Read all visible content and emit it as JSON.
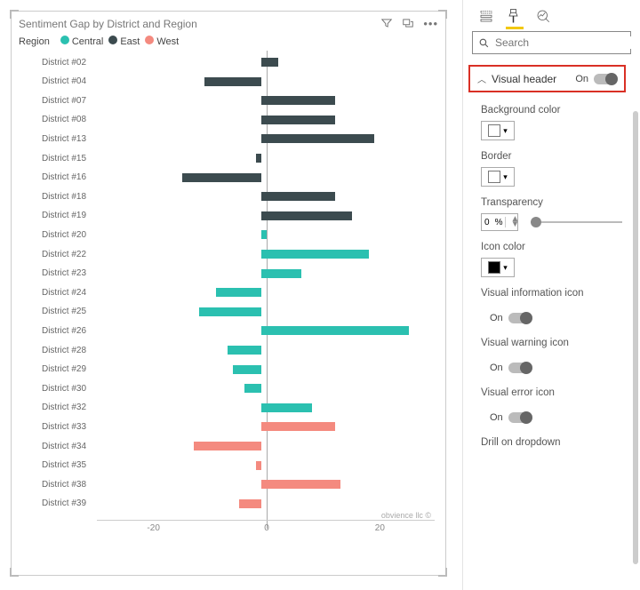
{
  "viz": {
    "title": "Sentiment Gap by District and Region",
    "legend_label": "Region",
    "legend": [
      {
        "name": "Central",
        "color": "#2bc0b0"
      },
      {
        "name": "East",
        "color": "#3c4b4f"
      },
      {
        "name": "West",
        "color": "#f48a7f"
      }
    ],
    "copyright": "obvience llc ©"
  },
  "actions": {
    "filter_icon": "filter-icon",
    "focus_icon": "focus-mode-icon",
    "more_icon": "more-options-icon"
  },
  "axis": {
    "ticks": [
      -20,
      0,
      20
    ],
    "min": -30,
    "max": 30
  },
  "chart_data": {
    "type": "bar",
    "orientation": "horizontal",
    "categories": [
      "District #02",
      "District #04",
      "District #07",
      "District #08",
      "District #13",
      "District #15",
      "District #16",
      "District #18",
      "District #19",
      "District #20",
      "District #22",
      "District #23",
      "District #24",
      "District #25",
      "District #26",
      "District #28",
      "District #29",
      "District #30",
      "District #32",
      "District #33",
      "District #34",
      "District #35",
      "District #38",
      "District #39"
    ],
    "series": [
      {
        "name": "Central",
        "color": "#2bc0b0",
        "values": [
          null,
          null,
          null,
          null,
          null,
          null,
          null,
          null,
          null,
          1,
          19,
          7,
          -8,
          -11,
          26,
          -6,
          -5,
          -3,
          9,
          null,
          null,
          null,
          null,
          null
        ]
      },
      {
        "name": "East",
        "color": "#3c4b4f",
        "values": [
          3,
          -10,
          13,
          13,
          20,
          -1,
          -14,
          13,
          16,
          null,
          null,
          null,
          null,
          null,
          null,
          null,
          null,
          null,
          null,
          null,
          null,
          null,
          null,
          null
        ]
      },
      {
        "name": "West",
        "color": "#f48a7f",
        "values": [
          null,
          null,
          null,
          null,
          null,
          null,
          null,
          null,
          null,
          null,
          null,
          null,
          null,
          null,
          null,
          null,
          null,
          null,
          null,
          13,
          -12,
          -1,
          14,
          -4
        ]
      }
    ],
    "xlabel": "",
    "ylabel": "",
    "xlim": [
      -30,
      30
    ],
    "title": "Sentiment Gap by District and Region"
  },
  "format": {
    "search_placeholder": "Search",
    "section": {
      "label": "Visual header",
      "state": "On"
    },
    "props": {
      "bg_color": {
        "label": "Background color",
        "value": "#ffffff"
      },
      "border": {
        "label": "Border",
        "value": "#ffffff"
      },
      "transparency": {
        "label": "Transparency",
        "value": "0",
        "unit": "%"
      },
      "icon_color": {
        "label": "Icon color",
        "value": "#000000"
      },
      "visual_info": {
        "label": "Visual information icon",
        "state": "On"
      },
      "visual_warn": {
        "label": "Visual warning icon",
        "state": "On"
      },
      "visual_err": {
        "label": "Visual error icon",
        "state": "On"
      },
      "drill": {
        "label": "Drill on dropdown"
      }
    }
  }
}
